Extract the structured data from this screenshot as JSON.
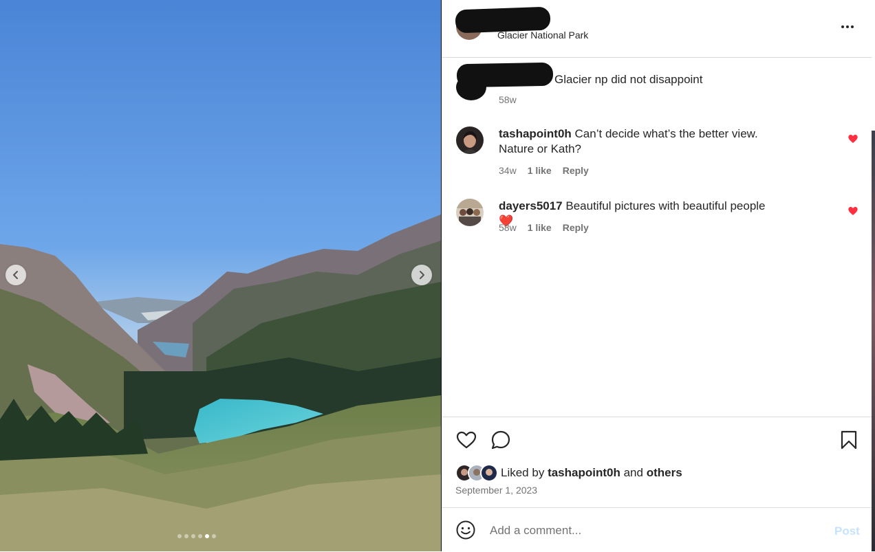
{
  "post": {
    "location": "Glacier National Park",
    "more_icon": "more-horizontal-icon"
  },
  "caption": {
    "text": "Glacier np did not disappoint",
    "age": "58w"
  },
  "comments": [
    {
      "username": "tashapoint0h",
      "text": "Can’t decide what’s the better view. Nature or Kath?",
      "age": "34w",
      "likes": "1 like",
      "reply": "Reply",
      "liked": true
    },
    {
      "username": "dayers5017",
      "text": "Beautiful pictures with beautiful people❤️",
      "age": "58w",
      "likes": "1 like",
      "reply": "Reply",
      "liked": true
    }
  ],
  "likes": {
    "prefix": "Liked by",
    "user": "tashapoint0h",
    "joiner": "and",
    "others": "others"
  },
  "date": "September 1, 2023",
  "composer": {
    "placeholder": "Add a comment...",
    "post_label": "Post"
  },
  "carousel": {
    "total": 6,
    "active_index": 4
  },
  "colors": {
    "like_red": "#ff3040",
    "post_disabled": "#c7e3fb",
    "meta_gray": "#737373",
    "divider": "#dbdbdb"
  }
}
